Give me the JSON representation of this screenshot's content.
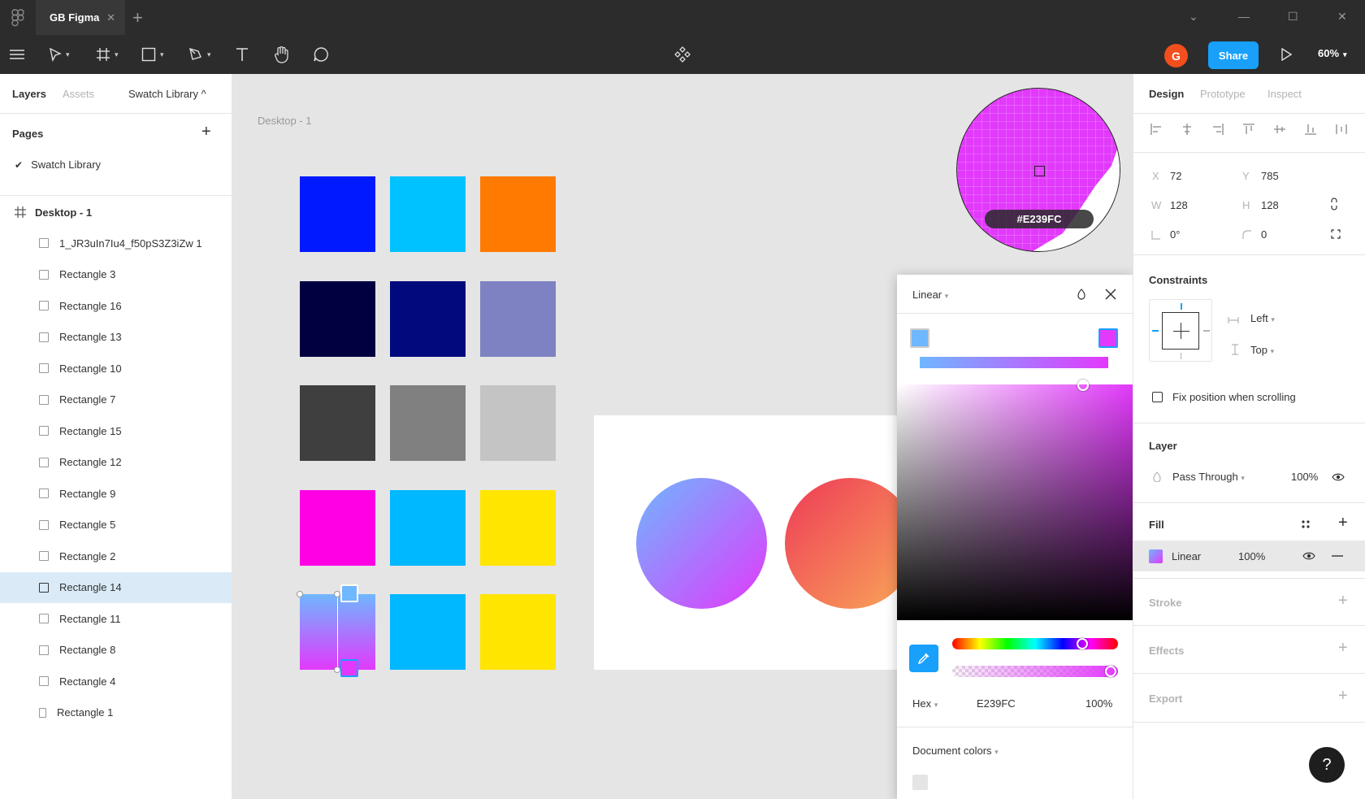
{
  "titlebar": {
    "tab_title": "GB Figma",
    "tab_close": "✕",
    "new_tab": "+",
    "chevron": "⌄",
    "minimize": "—",
    "maximize": "☐",
    "close": "✕"
  },
  "toolbar": {
    "avatar_initial": "G",
    "share_label": "Share",
    "zoom_label": "60%",
    "icons": [
      "menu-icon",
      "move-icon",
      "frame-icon",
      "rectangle-icon",
      "pen-icon",
      "text-icon",
      "hand-icon",
      "comment-icon",
      "components-icon",
      "play-icon"
    ]
  },
  "left_panel": {
    "tabs": [
      "Layers",
      "Assets",
      "Swatch Library ^"
    ],
    "pages_title": "Pages",
    "pages": [
      {
        "label": "Swatch Library",
        "checked": true
      }
    ],
    "frame_label": "Desktop - 1",
    "layers": [
      {
        "label": "1_JR3uIn7Iu4_f50pS3Z3iZw 1",
        "type": "image"
      },
      {
        "label": "Rectangle 3"
      },
      {
        "label": "Rectangle 16"
      },
      {
        "label": "Rectangle 13"
      },
      {
        "label": "Rectangle 10"
      },
      {
        "label": "Rectangle 7"
      },
      {
        "label": "Rectangle 15"
      },
      {
        "label": "Rectangle 12"
      },
      {
        "label": "Rectangle 9"
      },
      {
        "label": "Rectangle 5"
      },
      {
        "label": "Rectangle 2"
      },
      {
        "label": "Rectangle 14",
        "selected": true
      },
      {
        "label": "Rectangle 11"
      },
      {
        "label": "Rectangle 8"
      },
      {
        "label": "Rectangle 4"
      },
      {
        "label": "Rectangle 1"
      }
    ]
  },
  "canvas": {
    "frame_title": "Desktop - 1",
    "swatches": [
      [
        "#0019ff",
        "#00c2ff",
        "#ff7a00"
      ],
      [
        "#000040",
        "#000a7d",
        "#7e81c2"
      ],
      [
        "#3f3f3f",
        "#808080",
        "#c4c4c4"
      ],
      [
        "#ff00e5",
        "#00b8ff",
        "#ffe500"
      ],
      [
        "gradient",
        "#00b8ff",
        "#ffe500"
      ]
    ],
    "gradient_start": "#6fb7ff",
    "gradient_end": "#e239fc",
    "circle_a": [
      "#6fb7ff",
      "#e239fc"
    ],
    "circle_b": [
      "#ee3a57",
      "#f9a859"
    ]
  },
  "loupe": {
    "hex": "#E239FC"
  },
  "picker": {
    "mode": "Linear",
    "format": "Hex",
    "hex_value": "E239FC",
    "opacity": "100%",
    "doc_colors_label": "Document colors",
    "stop_left": "#6fb7ff",
    "stop_right": "#e239fc",
    "doc_swatch": "#e5e5e5"
  },
  "right_panel": {
    "tabs": [
      "Design",
      "Prototype",
      "Inspect"
    ],
    "x_label": "X",
    "x_value": "72",
    "y_label": "Y",
    "y_value": "785",
    "w_label": "W",
    "w_value": "128",
    "h_label": "H",
    "h_value": "128",
    "rotation": "0°",
    "radius": "0",
    "constraints_title": "Constraints",
    "constraint_h": "Left",
    "constraint_v": "Top",
    "fix_position": "Fix position when scrolling",
    "layer_title": "Layer",
    "blend_mode": "Pass Through",
    "layer_opacity": "100%",
    "fill_title": "Fill",
    "fill_type": "Linear",
    "fill_opacity": "100%",
    "stroke_title": "Stroke",
    "effects_title": "Effects",
    "export_title": "Export"
  },
  "help_label": "?"
}
